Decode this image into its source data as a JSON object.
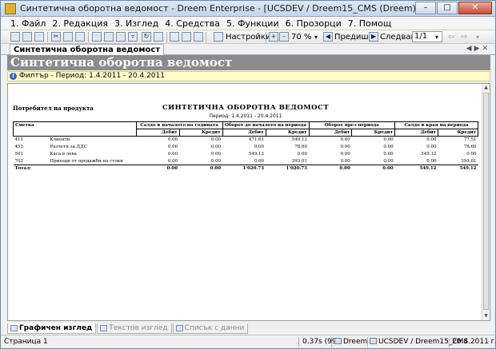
{
  "window": {
    "title": "Синтетична оборотна ведомост - Dreem Enterprise - [UCSDEV / Dreem15_CMS (Dreem)]",
    "controls": [
      "minimize-icon",
      "maximize-icon",
      "close-icon"
    ]
  },
  "menu": [
    "1. Файл",
    "2. Редакция",
    "3. Изглед",
    "4. Средства",
    "5. Функции",
    "6. Прозорци",
    "7. Помощ"
  ],
  "toolbar": {
    "settings_label": "Настройки...",
    "zoom_value": "70 %",
    "prev_label": "Предишна",
    "next_label": "Следваща",
    "page_value": "1/1"
  },
  "doc_tab": {
    "label": "Синтетична оборотна ведомост"
  },
  "header": {
    "title": "Синтетична оборотна ведомост"
  },
  "filter": {
    "text": "Филтър - Период: 1.4.2011 - 20.4.2011"
  },
  "report": {
    "product_label": "Потребител на продукта",
    "title": "СИНТЕТИЧНА ОБОРОТНА ВЕДОМОСТ",
    "period": "Период: 1.4.2011 - 20.4.2011",
    "columns": {
      "account": "Сметка",
      "groups": [
        "Салдо в началото на годината",
        "Оборот до началото на периода",
        "Оборот през периода",
        "Салдо в края на периода"
      ],
      "debit": "Дебит",
      "credit": "Кредит"
    },
    "rows": [
      {
        "code": "411",
        "name": "Клиенти",
        "values": [
          "0.00",
          "0.00",
          "471.61",
          "549.12",
          "0.00",
          "0.00",
          "0.00",
          "77.51"
        ]
      },
      {
        "code": "453",
        "name": "Разчети за ДДС",
        "values": [
          "0.00",
          "0.00",
          "0.00",
          "78.60",
          "0.00",
          "0.00",
          "0.00",
          "78.60"
        ]
      },
      {
        "code": "501",
        "name": "Каса в лева",
        "values": [
          "0.00",
          "0.00",
          "549.12",
          "0.00",
          "0.00",
          "0.00",
          "549.12",
          "0.00"
        ]
      },
      {
        "code": "702",
        "name": "Приходи от продажби на стоки",
        "values": [
          "0.00",
          "0.00",
          "0.00",
          "393.01",
          "0.00",
          "0.00",
          "0.00",
          "393.01"
        ]
      }
    ],
    "total": {
      "label": "Тотал:",
      "values": [
        "0.00",
        "0.00",
        "1'020.73",
        "1'020.73",
        "0.00",
        "0.00",
        "549.12",
        "549.12"
      ]
    }
  },
  "view_tabs": [
    "Графичен изглед",
    "Текстов изглед",
    "Списък с данни"
  ],
  "status": {
    "page": "Страница 1",
    "time": "0.37s (99)",
    "app": "Dreem",
    "connection": "UCSDEV / Dreem15_CMS",
    "date": "20.4.2011 г."
  }
}
